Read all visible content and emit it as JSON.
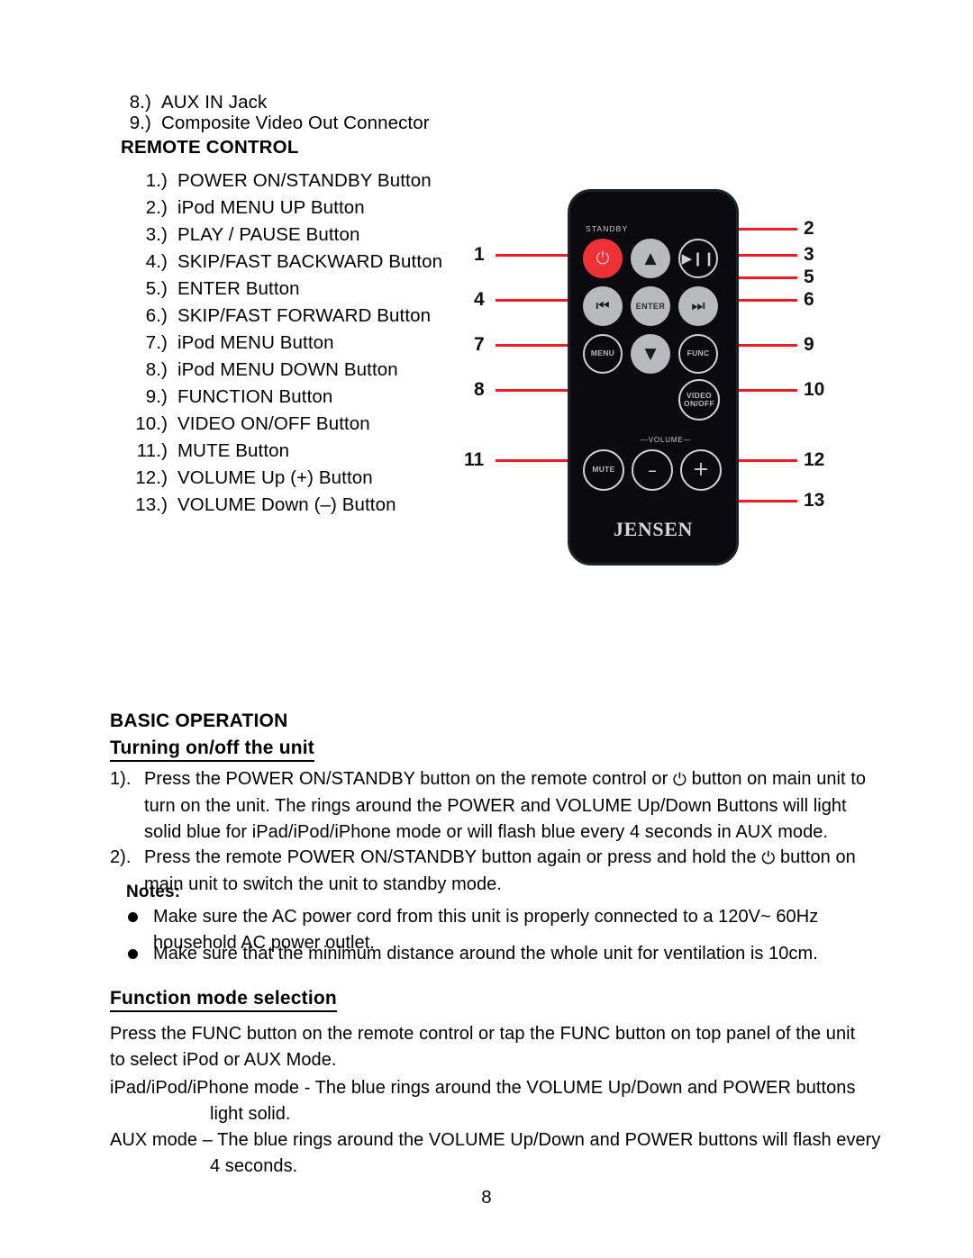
{
  "top_list": [
    {
      "num": "8.)",
      "label": "AUX IN Jack"
    },
    {
      "num": "9.)",
      "label": "Composite Video Out Connector"
    }
  ],
  "remote_control": {
    "heading": "REMOTE CONTROL",
    "items": [
      {
        "num": "1.)",
        "label": "POWER ON/STANDBY Button"
      },
      {
        "num": "2.)",
        "label": "iPod MENU UP Button"
      },
      {
        "num": "3.)",
        "label": "PLAY / PAUSE Button"
      },
      {
        "num": "4.)",
        "label": "SKIP/FAST BACKWARD Button"
      },
      {
        "num": "5.)",
        "label": "ENTER Button"
      },
      {
        "num": "6.)",
        "label": "SKIP/FAST FORWARD Button"
      },
      {
        "num": "7.)",
        "label": "iPod MENU Button"
      },
      {
        "num": "8.)",
        "label": "iPod MENU DOWN Button"
      },
      {
        "num": "9.)",
        "label": "FUNCTION Button"
      },
      {
        "num": "10.)",
        "label": "VIDEO ON/OFF Button"
      },
      {
        "num": "11.)",
        "label": "MUTE Button"
      },
      {
        "num": "12.)",
        "label": "VOLUME Up (+) Button"
      },
      {
        "num": "13.)",
        "label": "VOLUME Down (–) Button"
      }
    ]
  },
  "remote_figure": {
    "standby_label": "STANDBY",
    "volume_label": "—VOLUME—",
    "brand": "JENSEN",
    "buttons": {
      "power": "⏻",
      "up": "▲",
      "play_pause": "▶❙❙",
      "prev": "⏮",
      "enter": "ENTER",
      "next": "⏭",
      "menu": "MENU",
      "down": "▼",
      "func": "FUNC",
      "video_onoff_line1": "VIDEO",
      "video_onoff_line2": "ON/OFF",
      "mute": "MUTE",
      "vol_down": "–",
      "vol_up": "+"
    },
    "callouts_left": [
      "1",
      "4",
      "7",
      "8",
      "11"
    ],
    "callouts_right": [
      "2",
      "3",
      "5",
      "6",
      "9",
      "10",
      "12",
      "13"
    ],
    "leader_color": "#ee1c25"
  },
  "basic_operation": {
    "heading": "BASIC OPERATION",
    "subheading": "Turning on/off the unit",
    "steps": [
      {
        "num": "1).",
        "text_a": "Press the POWER ON/STANDBY button on the remote control or ",
        "icon": "power-icon",
        "text_b": " button on main unit to turn on the unit. The rings around the POWER and VOLUME Up/Down Buttons will light solid blue for iPad/iPod/iPhone mode or will flash blue every 4 seconds in AUX mode."
      },
      {
        "num": "2).",
        "text_a": "Press the remote POWER ON/STANDBY button again or press and hold the ",
        "icon": "power-icon",
        "text_b": " button on main unit to switch the unit to standby mode."
      }
    ],
    "notes_heading": "Notes:",
    "notes": [
      "Make sure the AC power cord from this unit is properly connected to a 120V~ 60Hz household AC power outlet.",
      "Make sure that the minimum distance around the whole unit for ventilation is 10cm."
    ]
  },
  "function_mode": {
    "subheading": "Function mode selection",
    "intro": "Press the FUNC button on the remote control or tap the FUNC button on top panel of the unit to select iPod or AUX Mode.",
    "modes": [
      {
        "line1": "iPad/iPod/iPhone mode - The blue rings around the VOLUME Up/Down and POWER buttons",
        "line2": "light solid."
      },
      {
        "line1": "AUX mode – The blue rings around the VOLUME Up/Down and POWER buttons will flash every",
        "line2": "4 seconds."
      }
    ]
  },
  "footer": {
    "page_number": "8"
  }
}
